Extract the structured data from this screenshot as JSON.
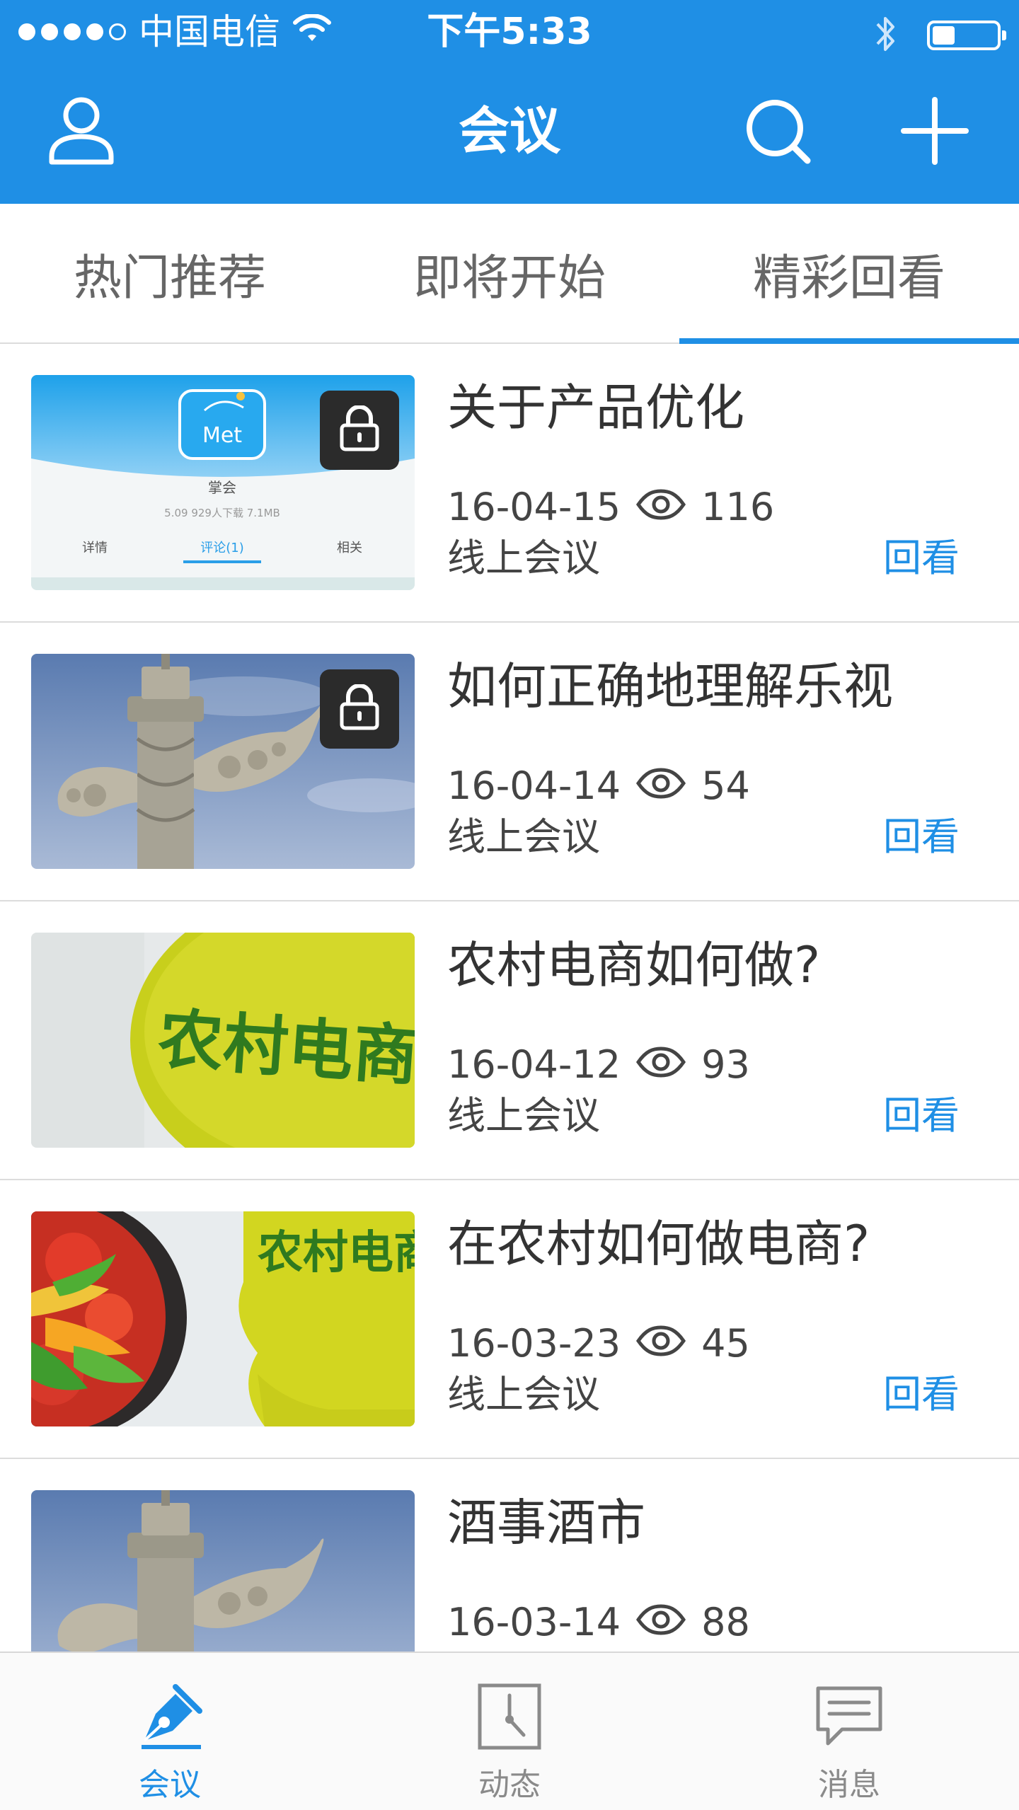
{
  "status_bar": {
    "carrier": "中国电信",
    "time": "下午5:33",
    "battery_level": 0.35
  },
  "nav": {
    "title": "会议",
    "icons": {
      "profile": "person-icon",
      "search": "search-icon",
      "add": "plus-icon"
    }
  },
  "tabs": [
    {
      "label": "热门推荐",
      "active": false
    },
    {
      "label": "即将开始",
      "active": false
    },
    {
      "label": "精彩回看",
      "active": true
    }
  ],
  "meetings": [
    {
      "title": "关于产品优化",
      "date": "16-04-15",
      "views": "116",
      "type": "线上会议",
      "action": "回看",
      "locked": true,
      "thumb": {
        "app_logo": "Met",
        "app_name": "掌会",
        "app_stats": "5.09  929人下载  7.1MB",
        "tab_detail": "详情",
        "tab_comment": "评论(1)",
        "tab_related": "相关"
      }
    },
    {
      "title": "如何正确地理解乐视",
      "date": "16-04-14",
      "views": "54",
      "type": "线上会议",
      "action": "回看",
      "locked": true,
      "thumb": {}
    },
    {
      "title": "农村电商如何做?",
      "date": "16-04-12",
      "views": "93",
      "type": "线上会议",
      "action": "回看",
      "locked": false,
      "thumb": {
        "sign_text": "农村电商"
      }
    },
    {
      "title": "在农村如何做电商?",
      "date": "16-03-23",
      "views": "45",
      "type": "线上会议",
      "action": "回看",
      "locked": false,
      "thumb": {
        "sign_text": "农村电商"
      }
    },
    {
      "title": "酒事酒市",
      "date": "16-03-14",
      "views": "88",
      "type": "",
      "action": "",
      "locked": false,
      "thumb": {}
    }
  ],
  "tabbar": [
    {
      "label": "会议",
      "icon": "pen-nib-icon",
      "active": true
    },
    {
      "label": "动态",
      "icon": "clock-icon",
      "active": false
    },
    {
      "label": "消息",
      "icon": "chat-bubble-icon",
      "active": false
    }
  ],
  "colors": {
    "brand_blue": "#1f8fe5",
    "tab_text": "#666666",
    "divider": "#dcdcdc"
  }
}
